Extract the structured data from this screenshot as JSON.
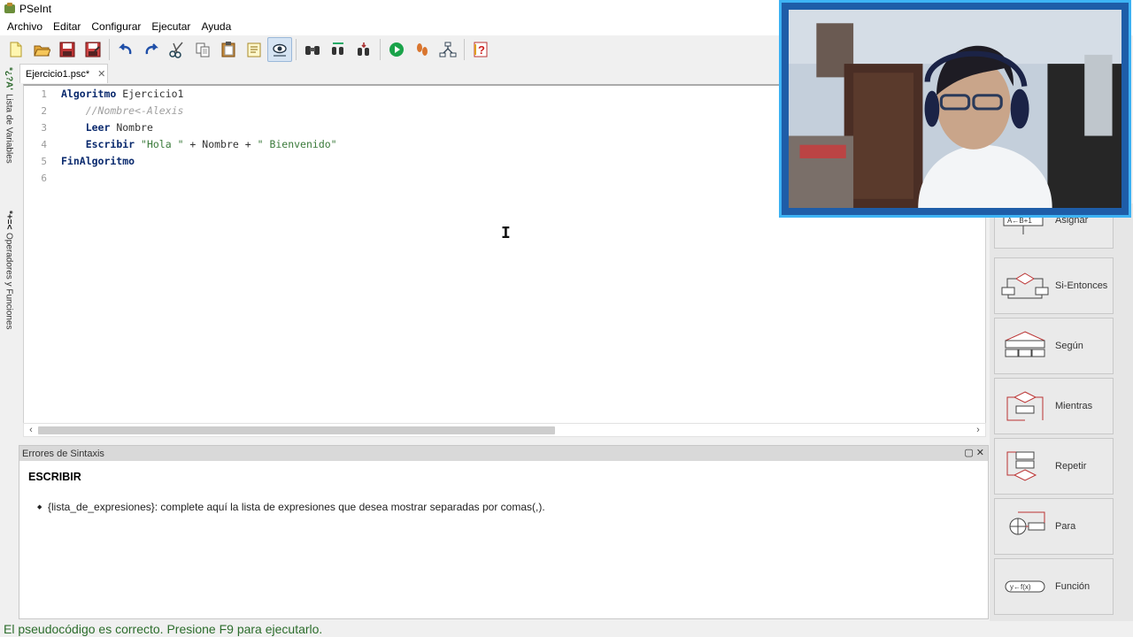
{
  "window": {
    "title": "PSeInt",
    "icon": "pseint-icon"
  },
  "menu": [
    "Archivo",
    "Editar",
    "Configurar",
    "Ejecutar",
    "Ayuda"
  ],
  "toolbar": {
    "buttons": [
      "new-icon",
      "open-icon",
      "save-icon",
      "save-as-icon",
      "undo-icon",
      "redo-icon",
      "cut-icon",
      "copy-icon",
      "paste-icon",
      "edit-list-icon",
      "find-icon",
      "search-icon",
      "replace-icon",
      "indent-icon",
      "run-icon",
      "step-icon",
      "flowchart-icon",
      "help-icon"
    ]
  },
  "left_tabs": {
    "variables": {
      "glyphs": "*¿?A'",
      "label": "Lista de Variables"
    },
    "operators": {
      "glyphs": "*+=<",
      "label": "Operadores y Funciones"
    }
  },
  "editor": {
    "tab_label": "Ejercicio1.psc*",
    "lines": [
      {
        "n": "1",
        "parts": [
          {
            "t": "Algoritmo",
            "c": "kw"
          },
          {
            "t": " Ejercicio1",
            "c": "id"
          }
        ]
      },
      {
        "n": "2",
        "parts": [
          {
            "t": "    //Nombre<-Alexis",
            "c": "cmt"
          }
        ]
      },
      {
        "n": "3",
        "parts": [
          {
            "t": "    ",
            "c": "id"
          },
          {
            "t": "Leer",
            "c": "kw"
          },
          {
            "t": " Nombre",
            "c": "id"
          }
        ]
      },
      {
        "n": "4",
        "parts": [
          {
            "t": "    ",
            "c": "id"
          },
          {
            "t": "Escribir",
            "c": "kw"
          },
          {
            "t": " ",
            "c": "id"
          },
          {
            "t": "\"Hola \"",
            "c": "str"
          },
          {
            "t": " + Nombre + ",
            "c": "op"
          },
          {
            "t": "\" Bienvenido\"",
            "c": "str"
          }
        ]
      },
      {
        "n": "5",
        "parts": [
          {
            "t": "FinAlgoritmo",
            "c": "kw"
          }
        ]
      },
      {
        "n": "6",
        "parts": []
      }
    ]
  },
  "errors": {
    "header": "Errores de Sintaxis",
    "title": "ESCRIBIR",
    "item": "{lista_de_expresiones}: complete aquí la lista de expresiones que desea mostrar separadas por comas(,)."
  },
  "commands": [
    {
      "label": "Asignar",
      "icon": "assign-icon"
    },
    {
      "label": "Si-Entonces",
      "icon": "if-then-icon"
    },
    {
      "label": "Según",
      "icon": "switch-icon"
    },
    {
      "label": "Mientras",
      "icon": "while-icon"
    },
    {
      "label": "Repetir",
      "icon": "repeat-icon"
    },
    {
      "label": "Para",
      "icon": "for-icon"
    },
    {
      "label": "Función",
      "icon": "function-icon"
    }
  ],
  "status": "El pseudocódigo es correcto. Presione F9 para ejecutarlo.",
  "colors": {
    "keyword": "#0a2a6e",
    "string": "#3a7a3a",
    "comment": "#a0a0a0",
    "status": "#2c6d2c",
    "webcam_border": "#3db3f4"
  }
}
